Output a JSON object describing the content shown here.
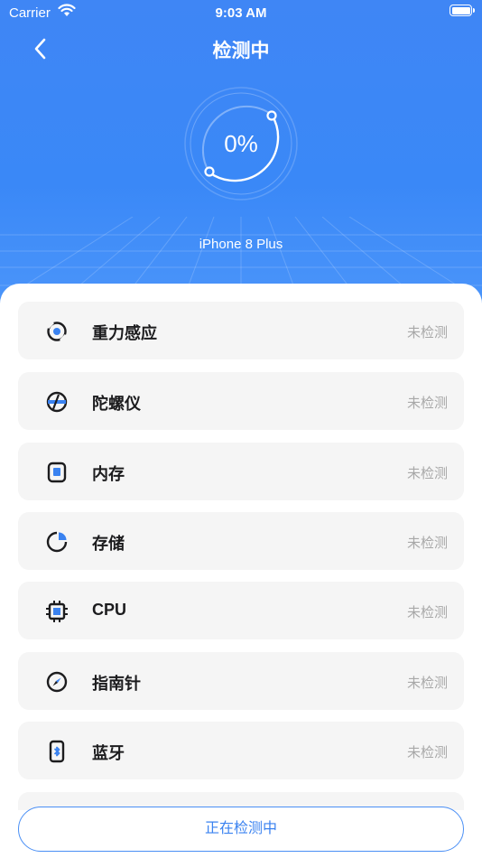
{
  "status": {
    "carrier": "Carrier",
    "time": "9:03 AM"
  },
  "header": {
    "title": "检测中",
    "progress": "0%",
    "device": "iPhone 8 Plus"
  },
  "items": [
    {
      "name": "重力感应",
      "state": "未检测",
      "icon": "gravity-sensor-icon"
    },
    {
      "name": "陀螺仪",
      "state": "未检测",
      "icon": "gyroscope-icon"
    },
    {
      "name": "内存",
      "state": "未检测",
      "icon": "memory-card-icon"
    },
    {
      "name": "存储",
      "state": "未检测",
      "icon": "storage-pie-icon"
    },
    {
      "name": "CPU",
      "state": "未检测",
      "icon": "cpu-chip-icon"
    },
    {
      "name": "指南针",
      "state": "未检测",
      "icon": "compass-icon"
    },
    {
      "name": "蓝牙",
      "state": "未检测",
      "icon": "bluetooth-icon"
    }
  ],
  "action": {
    "label": "正在检测中"
  },
  "colors": {
    "accent": "#3a88f7",
    "card": "#f5f5f5",
    "muted": "#a8a8a8"
  }
}
